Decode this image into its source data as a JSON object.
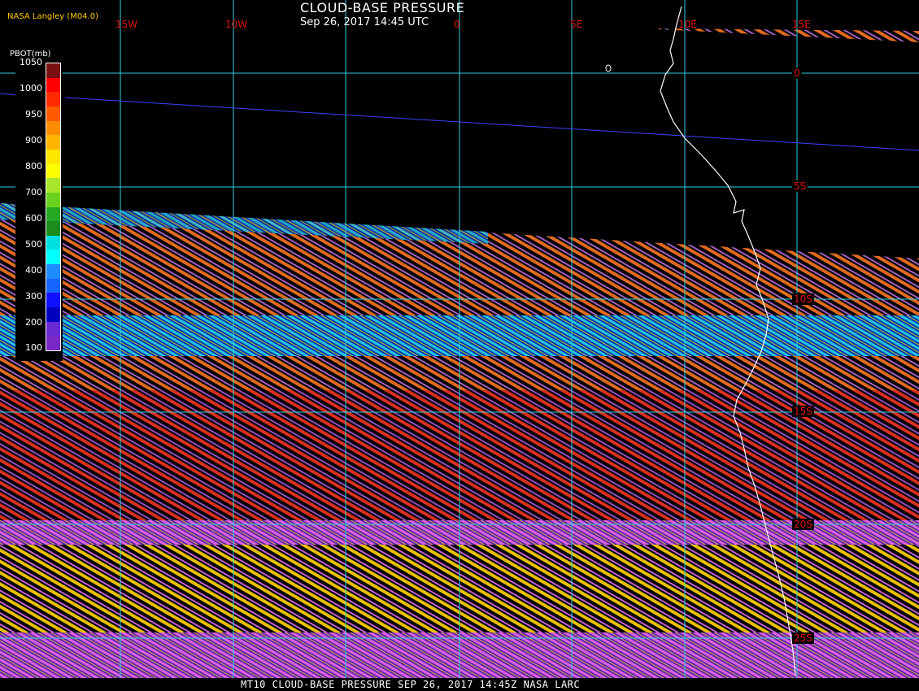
{
  "header": {
    "title": "CLOUD-BASE PRESSURE",
    "subtitle": "Sep 26, 2017 14:45 UTC",
    "organization": "NASA Langley (M04.0)"
  },
  "footer": {
    "text": "MT10  CLOUD-BASE PRESSURE   SEP 26, 2017 14:45Z   NASA LARC"
  },
  "legend": {
    "title": "PBOT(mb)",
    "labels": [
      "1050",
      "1000",
      "950",
      "900",
      "850",
      "800",
      "750",
      "700",
      "650",
      "600",
      "550",
      "500",
      "450",
      "400",
      "350",
      "300",
      "250",
      "200",
      "150",
      "100"
    ],
    "tick_labels": [
      "1050",
      "1000",
      "950",
      "900",
      "800",
      "700",
      "600",
      "500",
      "400",
      "300",
      "200",
      "100"
    ],
    "colors": [
      "#7a1010",
      "#ff0000",
      "#ff2a00",
      "#ff5a00",
      "#ff8c00",
      "#ffb400",
      "#ffe600",
      "#ffff00",
      "#a8e62e",
      "#6ad21e",
      "#22a822",
      "#1c8c1c",
      "#00e0e0",
      "#00ffff",
      "#1e8cff",
      "#1464ff",
      "#1010ff",
      "#0000c0",
      "#6a2ad2",
      "#7a28c8"
    ]
  },
  "grid": {
    "longitude_labels": [
      "15W",
      "10W",
      "0",
      "5E",
      "10E",
      "15E"
    ],
    "latitude_labels": [
      "0",
      "5S",
      "10S",
      "15S",
      "20S",
      "25S"
    ],
    "line_color": "#2ecfe0",
    "label_color": "#e01010"
  }
}
